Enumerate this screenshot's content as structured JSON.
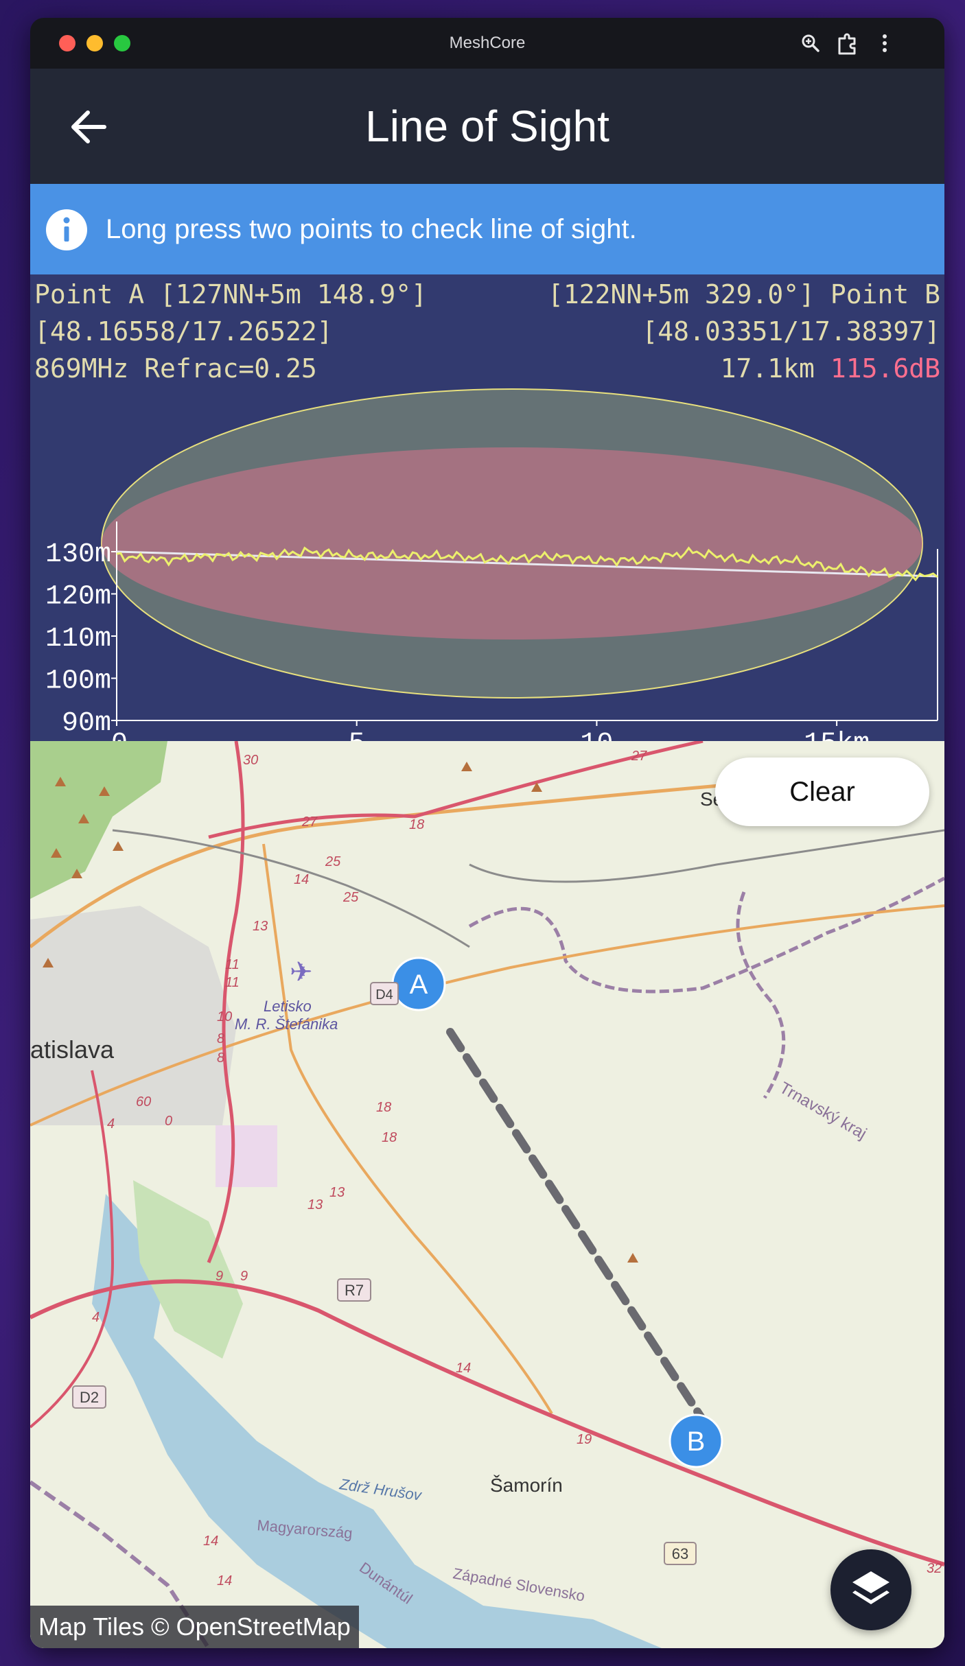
{
  "window": {
    "title": "MeshCore",
    "controls": [
      "close",
      "minimize",
      "maximize"
    ],
    "icons": [
      "zoom-icon",
      "extension-icon",
      "more-vert-icon"
    ]
  },
  "header": {
    "title": "Line of Sight",
    "back_icon": "arrow-back-icon"
  },
  "info_banner": {
    "icon": "info-icon",
    "text": "Long press two points to check line of sight."
  },
  "los": {
    "point_a": {
      "line1": "Point A [127NN+5m 148.9°]",
      "line2": "[48.16558/17.26522]"
    },
    "point_b": {
      "line1": "[122NN+5m 329.0°] Point B",
      "line2": "[48.03351/17.38397]"
    },
    "freq": "869MHz Refrac=0.25",
    "distance": "17.1km",
    "loss": "115.6dB",
    "loss_color": "#ff6f8f"
  },
  "chart_data": {
    "type": "line",
    "title": "",
    "xlabel": "",
    "ylabel": "",
    "x_ticks": [
      "0",
      "5",
      "10",
      "15km"
    ],
    "y_ticks": [
      "90m",
      "100m",
      "110m",
      "120m",
      "130m"
    ],
    "xlim": [
      0,
      17.1
    ],
    "ylim": [
      90,
      130
    ],
    "series": [
      {
        "x": [
          0,
          1,
          2,
          3,
          4,
          5,
          6,
          7,
          8,
          9,
          10,
          11,
          12,
          13,
          14,
          15,
          16,
          17.1
        ],
        "values": [
          129,
          128,
          129,
          129,
          130,
          129,
          129,
          129,
          128,
          129,
          128,
          128,
          130,
          128,
          128,
          126,
          125,
          124
        ]
      }
    ]
  },
  "map": {
    "clear_label": "Clear",
    "layers_icon": "layers-icon",
    "attribution": "Map Tiles © OpenStreetMap",
    "marker_a": "A",
    "marker_b": "B",
    "labels": {
      "city": "atislava",
      "airport1": "Letisko",
      "airport2": "M. R. Štefánika",
      "samorin": "Šamorín",
      "trnavsky": "Trnavský kraj",
      "zdrz": "Zdrž Hrušov",
      "magyar": "Magyarország",
      "dunantul": "Dunántúl",
      "zapadne": "Západné Slovensko",
      "se": "Se",
      "r7": "R7",
      "d2": "D2",
      "d4": "D4",
      "r63": "63",
      "n27a": "27",
      "n27b": "27",
      "n30": "30",
      "n18a": "18",
      "n25a": "25",
      "n25b": "25",
      "n14a": "14",
      "n13a": "13",
      "n11a": "11",
      "n11b": "11",
      "n10": "10",
      "n8a": "8",
      "n8b": "8",
      "n60": "60",
      "n4a": "4",
      "n0": "0",
      "n18b": "18",
      "n18c": "18",
      "n13b": "13",
      "n13c": "13",
      "n9a": "9",
      "n9b": "9",
      "n4b": "4",
      "n14b": "14",
      "n19": "19",
      "n14c": "14",
      "n14d": "14",
      "n32": "32"
    }
  }
}
